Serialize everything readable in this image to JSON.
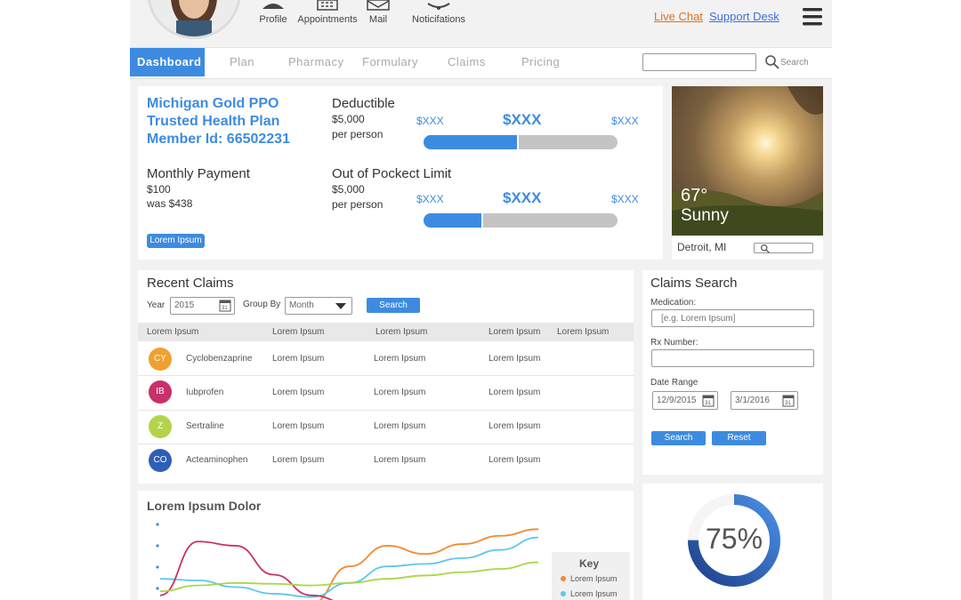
{
  "topbar": {
    "icons": [
      {
        "label": "Profile",
        "icon": "user-icon"
      },
      {
        "label": "Appointments",
        "icon": "calendar-icon"
      },
      {
        "label": "Mail",
        "icon": "mail-icon"
      },
      {
        "label": "Noticifations",
        "icon": "bell-icon"
      }
    ],
    "live_chat": "Live Chat",
    "support_desk": "Support Desk",
    "live_chat_color": "#e0701e",
    "support_color": "#3d6ee0"
  },
  "nav": {
    "tabs": [
      "Dashboard",
      "Plan",
      "Pharmacy",
      "Formulary",
      "Claims",
      "Pricing"
    ],
    "active": "Dashboard",
    "search_placeholder": "Search",
    "accent": "#3d8be0"
  },
  "plan": {
    "line1": "Michigan Gold PPO",
    "line2": "Trusted Health Plan",
    "line3": "Member Id: 66502231",
    "monthly_title": "Monthly Payment",
    "monthly_value": "$100",
    "monthly_was": "was $438",
    "badge": "Lorem Ipsum",
    "deductible": {
      "title": "Deductible",
      "value": "$5,000",
      "unit": "per person",
      "min": "$XXX",
      "mid": "$XXX",
      "max": "$XXX",
      "fill": 0.48
    },
    "oop": {
      "title": "Out of Pockect Limit",
      "value": "$5,000",
      "unit": "per person",
      "min": "$XXX",
      "mid": "$XXX",
      "max": "$XXX",
      "fill": 0.3
    }
  },
  "weather": {
    "temp": "67°",
    "condition": "Sunny",
    "location": "Detroit, MI"
  },
  "recent_claims": {
    "title": "Recent Claims",
    "year_label": "Year",
    "year_value": "2015",
    "group_label": "Group By",
    "group_value": "Month",
    "search_label": "Search",
    "headers": [
      "Lorem Ipsum",
      "Lorem Ipsum",
      "Lorem Ipsum",
      "Lorem Ipsum",
      "Lorem Ipsum"
    ],
    "rows": [
      {
        "initials": "CY",
        "color": "#f0a030",
        "name": "Cyclobenzaprine",
        "c1": "Lorem Ipsum",
        "c2": "Lorem Ipsum",
        "c3": "Lorem Ipsum"
      },
      {
        "initials": "IB",
        "color": "#c8306a",
        "name": "Iubprofen",
        "c1": "Lorem Ipsum",
        "c2": "Lorem Ipsum",
        "c3": "Lorem Ipsum"
      },
      {
        "initials": "Z",
        "color": "#b5d34a",
        "name": "Sertraline",
        "c1": "Lorem Ipsum",
        "c2": "Lorem Ipsum",
        "c3": "Lorem Ipsum"
      },
      {
        "initials": "CO",
        "color": "#2e5fb8",
        "name": "Acteaminophen",
        "c1": "Lorem Ipsum",
        "c2": "Lorem Ipsum",
        "c3": "Lorem Ipsum"
      }
    ]
  },
  "claims_search": {
    "title": "Claims Search",
    "medication_label": "Medication:",
    "medication_placeholder": "[e.g. Lorem Ipsum]",
    "rx_label": "Rx Number:",
    "date_label": "Date Range",
    "date_from": "12/9/2015",
    "date_to": "3/1/2016",
    "search_label": "Search",
    "reset_label": "Reset"
  },
  "chart": {
    "title": "Lorem Ipsum Dolor",
    "key_title": "Key",
    "key_items": [
      {
        "name": "Lorem Ipsum",
        "color": "#f08a30"
      },
      {
        "name": "Lorem Ipsum",
        "color": "#5bc8ea"
      }
    ]
  },
  "progress": {
    "value": "75%",
    "fraction": 0.75
  },
  "chart_data": {
    "type": "line",
    "title": "Lorem Ipsum Dolor",
    "x": [
      0,
      1,
      2,
      3,
      4,
      5,
      6,
      7,
      8,
      9,
      10
    ],
    "series": [
      {
        "name": "Lorem Ipsum",
        "color": "#f08a30",
        "values": [
          0,
          0,
          0,
          0,
          0,
          0.45,
          0.7,
          0.6,
          0.72,
          0.82,
          0.9
        ]
      },
      {
        "name": "Lorem Ipsum",
        "color": "#5bc8ea",
        "values": [
          0.3,
          0.28,
          0.2,
          0.12,
          0.08,
          0.25,
          0.45,
          0.48,
          0.55,
          0.65,
          0.8
        ]
      },
      {
        "color": "#c8306a",
        "values": [
          0.1,
          0.75,
          0.7,
          0.35,
          0.1,
          0.0,
          0.0,
          0.0,
          0.0,
          0.0,
          0.0
        ]
      },
      {
        "color": "#a8d848",
        "values": [
          0.15,
          0.22,
          0.25,
          0.24,
          0.22,
          0.25,
          0.3,
          0.34,
          0.38,
          0.42,
          0.5
        ]
      }
    ]
  }
}
